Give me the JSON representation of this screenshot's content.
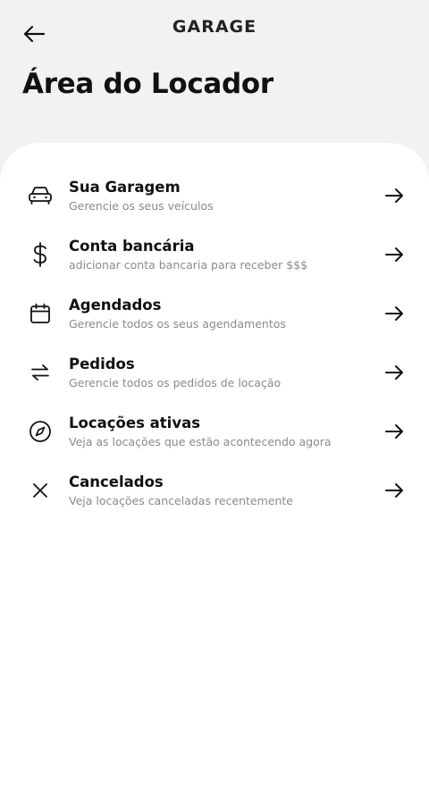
{
  "header": {
    "logo_text": "GARAGE",
    "back_icon": "arrow-left-icon"
  },
  "page_title": "Área do Locador",
  "menu": [
    {
      "icon": "car-icon",
      "label": "Sua Garagem",
      "description": "Gerencie os seus veículos"
    },
    {
      "icon": "dollar-icon",
      "label": "Conta bancária",
      "description": "adicionar conta bancaria para receber $$$"
    },
    {
      "icon": "calendar-icon",
      "label": "Agendados",
      "description": "Gerencie todos os seus agendamentos"
    },
    {
      "icon": "swap-arrows-icon",
      "label": "Pedidos",
      "description": "Gerencie todos os pedidos de locação"
    },
    {
      "icon": "compass-icon",
      "label": "Locações ativas",
      "description": "Veja as locações que estão acontecendo agora"
    },
    {
      "icon": "x-icon",
      "label": "Cancelados",
      "description": "Veja locações canceladas recentemente"
    }
  ],
  "colors": {
    "background": "#f2f2f3",
    "card": "#ffffff",
    "text": "#111111",
    "muted": "#8a8a8a"
  }
}
